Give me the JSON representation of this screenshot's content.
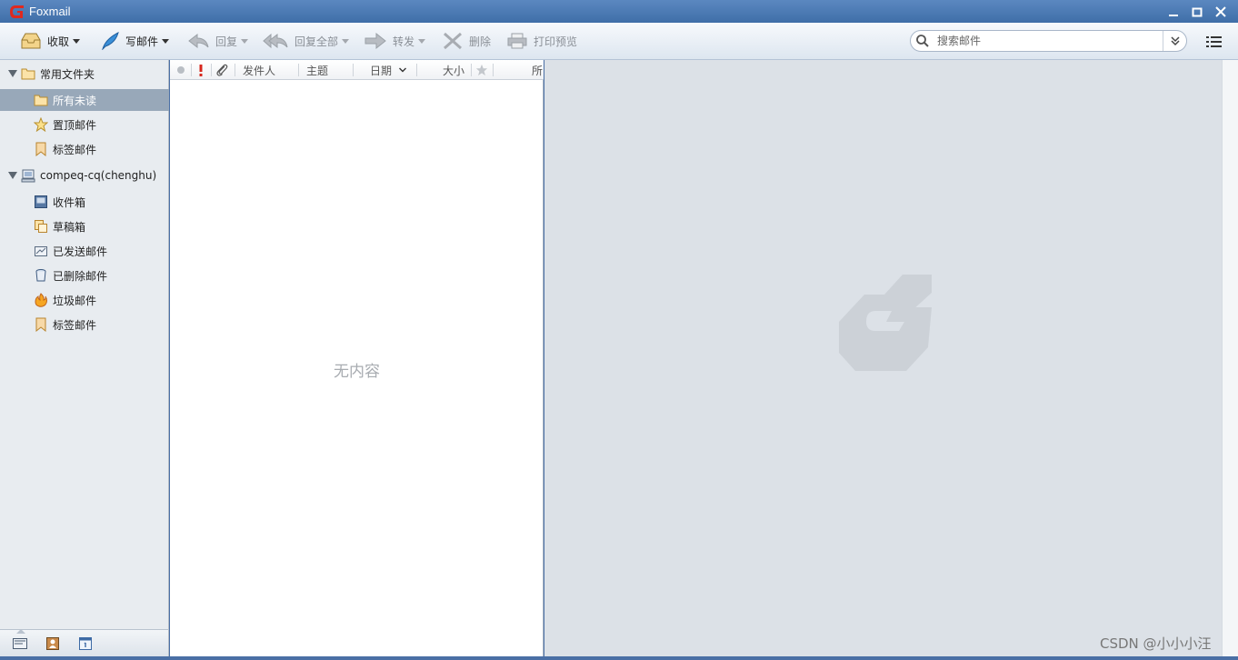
{
  "window": {
    "title": "Foxmail",
    "controls": [
      "minimize-icon",
      "maximize-icon",
      "close-icon"
    ]
  },
  "toolbar": {
    "receive_label": "收取",
    "compose_label": "写邮件",
    "reply_label": "回复",
    "reply_all_label": "回复全部",
    "forward_label": "转发",
    "delete_label": "删除",
    "print_preview_label": "打印预览"
  },
  "search": {
    "placeholder": "搜索邮件"
  },
  "sidebar": {
    "groups": [
      {
        "label": "常用文件夹",
        "icon": "folder-icon",
        "items": [
          {
            "label": "所有未读",
            "icon": "folder-icon",
            "selected": true
          },
          {
            "label": "置顶邮件",
            "icon": "star-icon"
          },
          {
            "label": "标签邮件",
            "icon": "bookmark-icon"
          }
        ]
      },
      {
        "label": "compeq-cq(chenghu)",
        "icon": "account-icon",
        "items": [
          {
            "label": "收件箱",
            "icon": "inbox-icon"
          },
          {
            "label": "草稿箱",
            "icon": "drafts-icon"
          },
          {
            "label": "已发送邮件",
            "icon": "sent-icon"
          },
          {
            "label": "已删除邮件",
            "icon": "trash-icon"
          },
          {
            "label": "垃圾邮件",
            "icon": "spam-icon"
          },
          {
            "label": "标签邮件",
            "icon": "bookmark-icon"
          }
        ]
      }
    ],
    "bottom_buttons": [
      "mail-view-icon",
      "contacts-icon",
      "calendar-icon"
    ]
  },
  "mail_list": {
    "columns": {
      "sender": "发件人",
      "subject": "主题",
      "date": "日期",
      "size": "大小",
      "folder": "所"
    },
    "empty_text": "无内容"
  },
  "watermark": "CSDN @小小小汪",
  "colors": {
    "titlebar": "#4a79b4",
    "selected_row": "#98a8b9",
    "preview_bg": "#dce1e7",
    "brand_red": "#d9261c"
  }
}
